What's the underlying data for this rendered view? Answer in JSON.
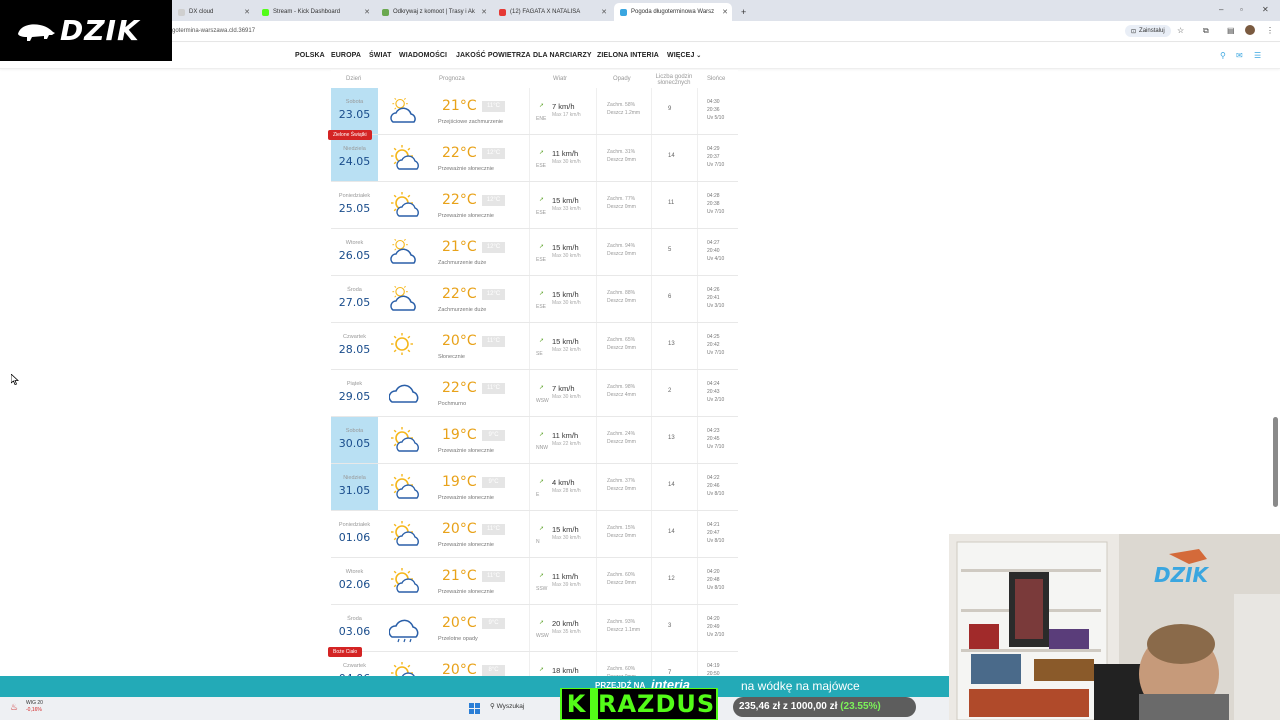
{
  "browser": {
    "tabs": [
      {
        "title": "DX cloud",
        "color": "#cfcfcf"
      },
      {
        "title": "Stream - Kick Dashboard",
        "color": "#53fc18"
      },
      {
        "title": "Odkrywaj z komoot | Trasy i Ak",
        "color": "#6aa84f"
      },
      {
        "title": "(12) FAGATA X NATALISA",
        "color": "#e53935"
      },
      {
        "title": "Pogoda długoterminowa Warsz",
        "color": "#3aa6e0"
      }
    ],
    "new_tab": "+",
    "url": "gotermina-warszawa.cld.36917",
    "install_label": "Zainstaluj"
  },
  "logo": {
    "text": "DZIK"
  },
  "nav": {
    "items": [
      "POLSKA",
      "EUROPA",
      "ŚWIAT",
      "WIADOMOŚCI",
      "JAKOŚĆ POWIETRZA",
      "DLA NARCIARZY",
      "ZIELONA INTERIA",
      "WIĘCEJ"
    ]
  },
  "table": {
    "headers": {
      "day": "Dzień",
      "forecast": "Prognoza",
      "wind": "Wiatr",
      "precip": "Opady",
      "sun_hours": "Liczba godzin słonecznych",
      "sun": "Słońce"
    },
    "rows": [
      {
        "dname": "Sobota",
        "date": "23.05",
        "highlight": true,
        "icon": "cloudy-sun-icon",
        "temp": "21°C",
        "tmin": "11°C",
        "desc": "Przejściowe zachmurzenie",
        "wdir": "ENE",
        "wspd": "7 km/h",
        "wmax": "Max 17 km/h",
        "p1": "Zachm. 58%",
        "p2": "Deszcz 1.2mm",
        "sunh": "9",
        "s1": "04:30",
        "s2": "20:36",
        "s3": "Uv 5/10"
      },
      {
        "dname": "Niedziela",
        "date": "24.05",
        "highlight": true,
        "holiday": "Zielone Świątki",
        "icon": "sun-cloud-icon",
        "temp": "22°C",
        "tmin": "12°C",
        "desc": "Przeważnie słonecznie",
        "wdir": "ESE",
        "wspd": "11 km/h",
        "wmax": "Max 30 km/h",
        "p1": "Zachm. 31%",
        "p2": "Deszcz 0mm",
        "sunh": "14",
        "s1": "04:29",
        "s2": "20:37",
        "s3": "Uv 7/10"
      },
      {
        "dname": "Poniedziałek",
        "date": "25.05",
        "highlight": false,
        "icon": "sun-cloud-icon",
        "temp": "22°C",
        "tmin": "12°C",
        "desc": "Przeważnie słonecznie",
        "wdir": "ESE",
        "wspd": "15 km/h",
        "wmax": "Max 33 km/h",
        "p1": "Zachm. 77%",
        "p2": "Deszcz 0mm",
        "sunh": "11",
        "s1": "04:28",
        "s2": "20:38",
        "s3": "Uv 7/10"
      },
      {
        "dname": "Wtorek",
        "date": "26.05",
        "highlight": false,
        "icon": "cloudy-sun-icon",
        "temp": "21°C",
        "tmin": "12°C",
        "desc": "Zachmurzenie duże",
        "wdir": "ESE",
        "wspd": "15 km/h",
        "wmax": "Max 30 km/h",
        "p1": "Zachm. 94%",
        "p2": "Deszcz 0mm",
        "sunh": "5",
        "s1": "04:27",
        "s2": "20:40",
        "s3": "Uv 4/10"
      },
      {
        "dname": "Środa",
        "date": "27.05",
        "highlight": false,
        "icon": "cloudy-sun-icon",
        "temp": "22°C",
        "tmin": "12°C",
        "desc": "Zachmurzenie duże",
        "wdir": "ESE",
        "wspd": "15 km/h",
        "wmax": "Max 30 km/h",
        "p1": "Zachm. 88%",
        "p2": "Deszcz 0mm",
        "sunh": "6",
        "s1": "04:26",
        "s2": "20:41",
        "s3": "Uv 3/10"
      },
      {
        "dname": "Czwartek",
        "date": "28.05",
        "highlight": false,
        "icon": "sun-icon",
        "temp": "20°C",
        "tmin": "11°C",
        "desc": "Słonecznie",
        "wdir": "SE",
        "wspd": "15 km/h",
        "wmax": "Max 32 km/h",
        "p1": "Zachm. 65%",
        "p2": "Deszcz 0mm",
        "sunh": "13",
        "s1": "04:25",
        "s2": "20:42",
        "s3": "Uv 7/10"
      },
      {
        "dname": "Piątek",
        "date": "29.05",
        "highlight": false,
        "icon": "cloud-icon",
        "temp": "22°C",
        "tmin": "11°C",
        "desc": "Pochmurno",
        "wdir": "WSW",
        "wspd": "7 km/h",
        "wmax": "Max 30 km/h",
        "p1": "Zachm. 98%",
        "p2": "Deszcz 4mm",
        "sunh": "2",
        "s1": "04:24",
        "s2": "20:43",
        "s3": "Uv 2/10"
      },
      {
        "dname": "Sobota",
        "date": "30.05",
        "highlight": true,
        "icon": "sun-cloud-icon",
        "temp": "19°C",
        "tmin": "9°C",
        "desc": "Przeważnie słonecznie",
        "wdir": "NNW",
        "wspd": "11 km/h",
        "wmax": "Max 22 km/h",
        "p1": "Zachm. 24%",
        "p2": "Deszcz 0mm",
        "sunh": "13",
        "s1": "04:23",
        "s2": "20:45",
        "s3": "Uv 7/10"
      },
      {
        "dname": "Niedziela",
        "date": "31.05",
        "highlight": true,
        "icon": "sun-cloud-icon",
        "temp": "19°C",
        "tmin": "9°C",
        "desc": "Przeważnie słonecznie",
        "wdir": "E",
        "wspd": "4 km/h",
        "wmax": "Max 28 km/h",
        "p1": "Zachm. 37%",
        "p2": "Deszcz 0mm",
        "sunh": "14",
        "s1": "04:22",
        "s2": "20:46",
        "s3": "Uv 8/10"
      },
      {
        "dname": "Poniedziałek",
        "date": "01.06",
        "highlight": false,
        "icon": "sun-cloud-icon",
        "temp": "20°C",
        "tmin": "11°C",
        "desc": "Przeważnie słonecznie",
        "wdir": "N",
        "wspd": "15 km/h",
        "wmax": "Max 30 km/h",
        "p1": "Zachm. 15%",
        "p2": "Deszcz 0mm",
        "sunh": "14",
        "s1": "04:21",
        "s2": "20:47",
        "s3": "Uv 8/10"
      },
      {
        "dname": "Wtorek",
        "date": "02.06",
        "highlight": false,
        "icon": "sun-cloud-icon",
        "temp": "21°C",
        "tmin": "11°C",
        "desc": "Przeważnie słonecznie",
        "wdir": "SSW",
        "wspd": "11 km/h",
        "wmax": "Max 39 km/h",
        "p1": "Zachm. 60%",
        "p2": "Deszcz 0mm",
        "sunh": "12",
        "s1": "04:20",
        "s2": "20:48",
        "s3": "Uv 8/10"
      },
      {
        "dname": "Środa",
        "date": "03.06",
        "highlight": false,
        "icon": "rain-cloud-icon",
        "temp": "20°C",
        "tmin": "9°C",
        "desc": "Przelotne opady",
        "wdir": "WSW",
        "wspd": "20 km/h",
        "wmax": "Max 35 km/h",
        "p1": "Zachm. 93%",
        "p2": "Deszcz 1.1mm",
        "sunh": "3",
        "s1": "04:20",
        "s2": "20:49",
        "s3": "Uv 2/10"
      },
      {
        "dname": "Czwartek",
        "date": "04.06",
        "highlight": false,
        "holiday": "Boże Ciało",
        "icon": "sun-cloud-icon",
        "temp": "20°C",
        "tmin": "8°C",
        "desc": "",
        "wdir": "WSW",
        "wspd": "18 km/h",
        "wmax": "Max 35 km/h",
        "p1": "Zachm. 60%",
        "p2": "Deszcz 0mm",
        "sunh": "7",
        "s1": "04:19",
        "s2": "20:50",
        "s3": ""
      }
    ]
  },
  "banner": {
    "promo": "PRZEJDŹ NA",
    "brand": "interia",
    "message": "na wódkę na majówce"
  },
  "kick": {
    "k": "K",
    "name": "RAZDUS"
  },
  "goal": {
    "text": "235,46 zł z 1000,00 zł",
    "pct": "(23.55%)"
  },
  "taskbar": {
    "wig": "WIG 20",
    "wig_change": "-0,16%",
    "search": "Wyszukaj"
  },
  "colors": {
    "accent": "#3aa6e0",
    "temp": "#e8a21a",
    "highlight": "#b9e0f3",
    "banner": "#23aab7",
    "kick": "#53fc18"
  }
}
